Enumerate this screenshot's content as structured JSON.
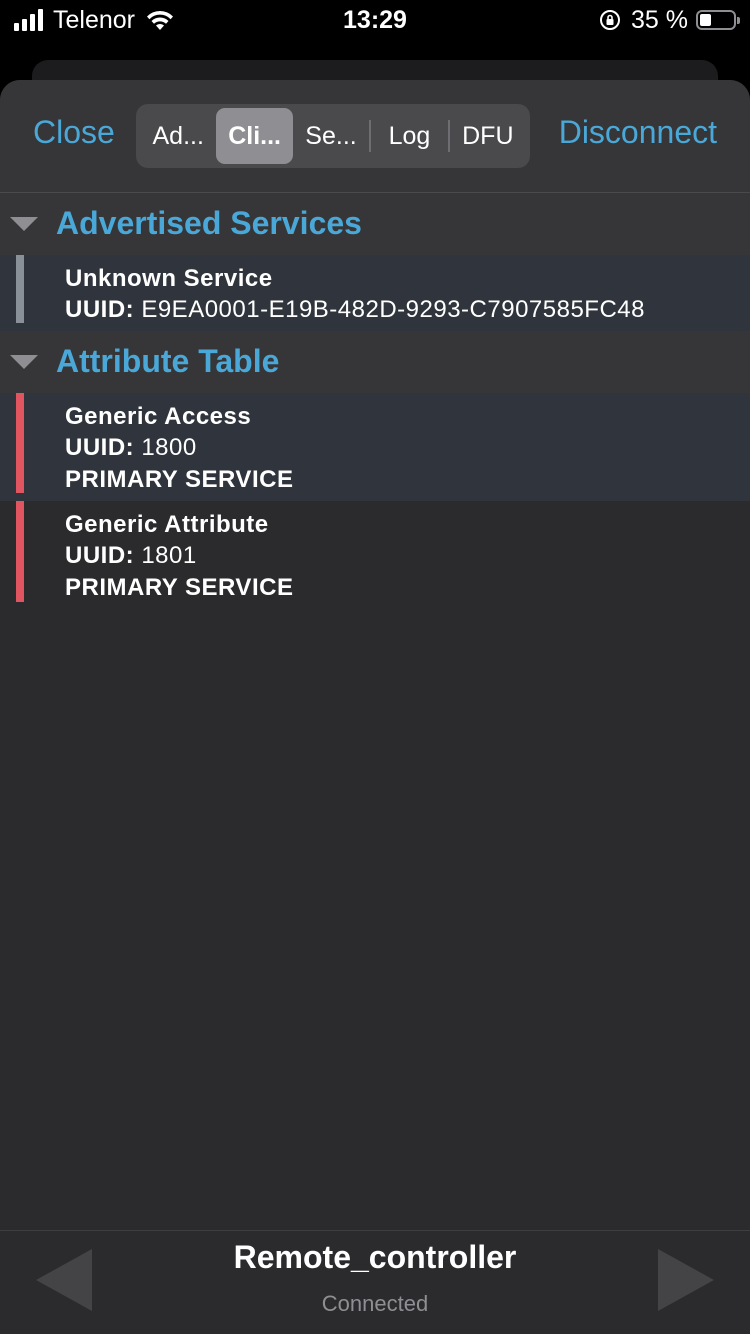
{
  "status_bar": {
    "carrier": "Telenor",
    "time": "13:29",
    "battery_percent": "35 %",
    "battery_level": 0.35
  },
  "toolbar": {
    "close_label": "Close",
    "disconnect_label": "Disconnect",
    "tabs": [
      {
        "label": "Ad..."
      },
      {
        "label": "Cli..."
      },
      {
        "label": "Se..."
      },
      {
        "label": "Log"
      },
      {
        "label": "DFU"
      }
    ],
    "selected_tab_index": 1
  },
  "sections": {
    "advertised": {
      "title": "Advertised Services",
      "items": [
        {
          "name": "Unknown Service",
          "uuid_label": "UUID:",
          "uuid": "E9EA0001-E19B-482D-9293-C7907585FC48"
        }
      ]
    },
    "attribute_table": {
      "title": "Attribute Table",
      "items": [
        {
          "name": "Generic Access",
          "uuid_label": "UUID:",
          "uuid": "1800",
          "type": "PRIMARY SERVICE"
        },
        {
          "name": "Generic Attribute",
          "uuid_label": "UUID:",
          "uuid": "1801",
          "type": "PRIMARY SERVICE"
        }
      ]
    }
  },
  "footer": {
    "device_name": "Remote_controller",
    "device_status": "Connected"
  },
  "colors": {
    "accent": "#4aa8d8",
    "service_bar_gray": "#8a9097",
    "service_bar_red": "#e0555f"
  }
}
